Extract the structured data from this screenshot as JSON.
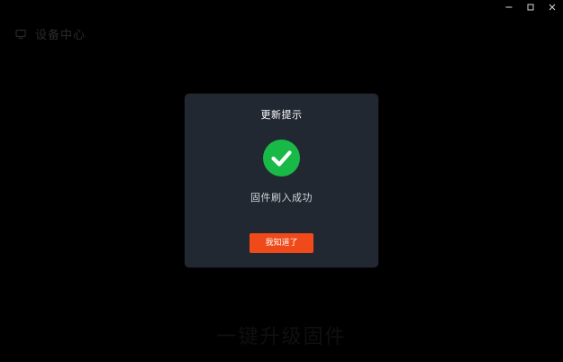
{
  "app": {
    "title": "设备中心",
    "icon": "device-icon"
  },
  "window_controls": {
    "minimize_icon": "minimize-icon",
    "maximize_icon": "maximize-icon",
    "close_icon": "close-icon"
  },
  "background": {
    "bottom_text": "一键升级固件"
  },
  "dialog": {
    "title": "更新提示",
    "status_icon": "check-circle-icon",
    "status_color": "#19b947",
    "message": "固件刷入成功",
    "confirm_label": "我知道了",
    "confirm_color": "#f04a1a"
  }
}
